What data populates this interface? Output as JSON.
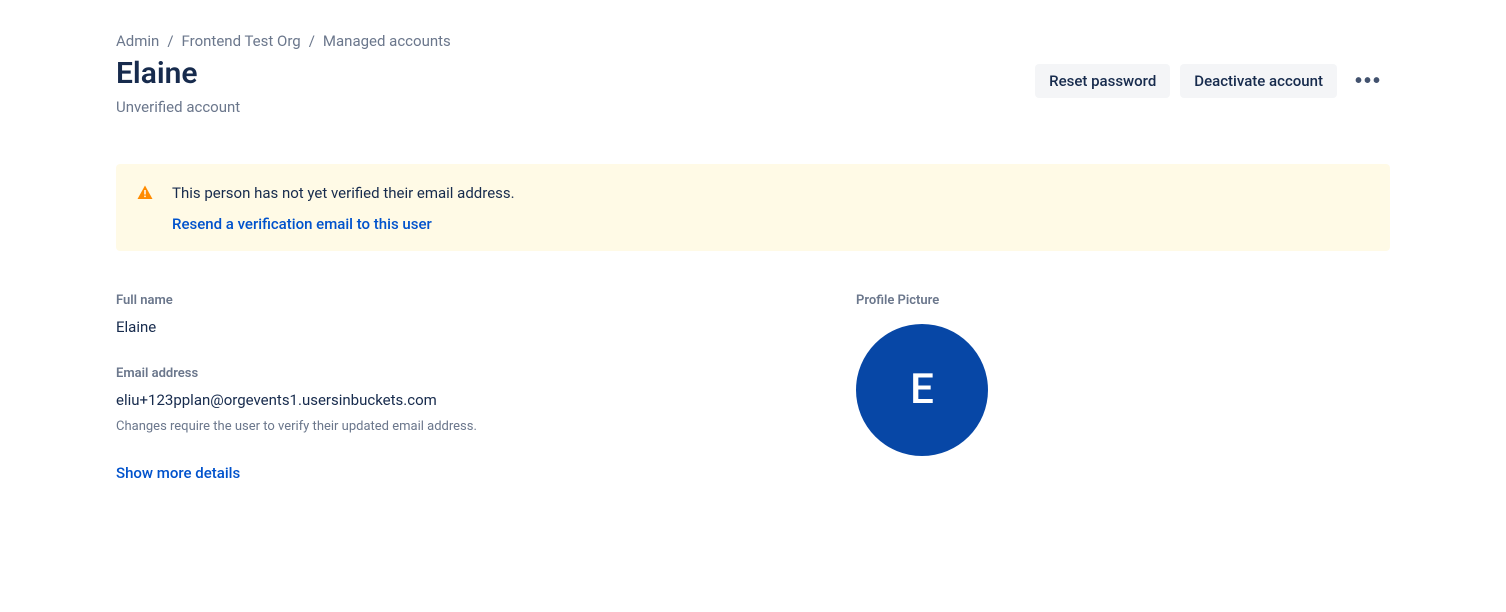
{
  "breadcrumb": {
    "items": [
      "Admin",
      "Frontend Test Org",
      "Managed accounts"
    ]
  },
  "header": {
    "title": "Elaine",
    "subtitle": "Unverified account"
  },
  "actions": {
    "reset_password": "Reset password",
    "deactivate": "Deactivate account"
  },
  "banner": {
    "message": "This person has not yet verified their email address.",
    "link_label": "Resend a verification email to this user"
  },
  "details": {
    "full_name_label": "Full name",
    "full_name_value": "Elaine",
    "email_label": "Email address",
    "email_value": "eliu+123pplan@orgevents1.usersinbuckets.com",
    "email_hint": "Changes require the user to verify their updated email address.",
    "show_more": "Show more details"
  },
  "profile_picture": {
    "label": "Profile Picture",
    "initial": "E"
  }
}
